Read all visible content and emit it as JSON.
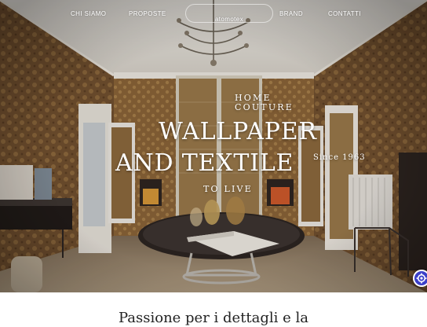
{
  "nav": {
    "items": [
      "CHI SIAMO",
      "PROPOSTE",
      "BRAND",
      "CONTATTI"
    ],
    "logo_text": "atomotex"
  },
  "hero": {
    "line_home": "HOME",
    "line_couture": "COUTURE",
    "line_wallpaper": "WALLPAPER",
    "line_and_textile": "AND TEXTILE",
    "since": "Since 1963",
    "to_live": "TO LIVE"
  },
  "section": {
    "title": "Passione per i dettagli e la"
  },
  "colors": {
    "accessibility_button": "#3b3fc8",
    "wallpaper": "#7a5532",
    "ceiling": "#e8e6e0",
    "floor": "#9c8a72"
  },
  "icons": {
    "accessibility": "accessibility-icon"
  }
}
